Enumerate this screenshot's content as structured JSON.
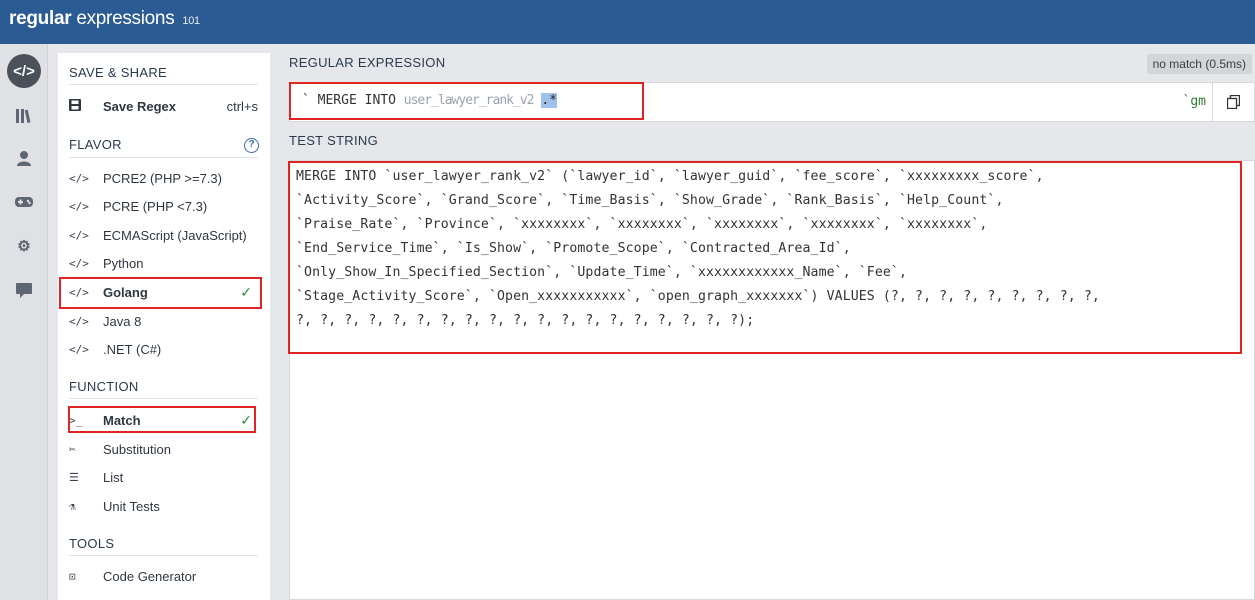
{
  "app": {
    "logo_main": "regular",
    "logo_sub": "expressions",
    "logo_num": "101"
  },
  "iconbar": {
    "items": [
      {
        "name": "code-icon",
        "glyph": "</>"
      },
      {
        "name": "library-icon",
        "glyph": "|||"
      },
      {
        "name": "user-icon",
        "glyph": "●"
      },
      {
        "name": "gamepad-icon",
        "glyph": "▬"
      },
      {
        "name": "gear-icon",
        "glyph": "⚙"
      },
      {
        "name": "chat-icon",
        "glyph": "▬"
      }
    ]
  },
  "sidebar": {
    "save_share_title": "SAVE & SHARE",
    "save_regex_label": "Save Regex",
    "save_regex_shortcut": "ctrl+s",
    "flavor_title": "FLAVOR",
    "flavors": [
      {
        "label": "PCRE2 (PHP >=7.3)"
      },
      {
        "label": "PCRE (PHP <7.3)"
      },
      {
        "label": "ECMAScript (JavaScript)"
      },
      {
        "label": "Python"
      },
      {
        "label": "Golang",
        "selected": true
      },
      {
        "label": "Java 8"
      },
      {
        "label": ".NET (C#)"
      }
    ],
    "function_title": "FUNCTION",
    "functions": [
      {
        "label": "Match",
        "selected": true
      },
      {
        "label": "Substitution"
      },
      {
        "label": "List"
      },
      {
        "label": "Unit Tests"
      }
    ],
    "tools_title": "TOOLS",
    "tools": [
      {
        "label": "Code Generator"
      }
    ]
  },
  "main": {
    "regex_label": "REGULAR EXPRESSION",
    "match_badge": "no match (0.5ms)",
    "regex_delim_open": "`",
    "regex_prefix": "MERGE INTO",
    "regex_obscured": "user_lawyer_rank_v2",
    "regex_highlight": ".*",
    "regex_flags": "`gm",
    "test_label": "TEST STRING",
    "test_lines": [
      "MERGE INTO `user_lawyer_rank_v2` (`lawyer_id`, `lawyer_guid`, `fee_score`, `xxxxxxxxx_score`,",
      "`Activity_Score`, `Grand_Score`, `Time_Basis`, `Show_Grade`, `Rank_Basis`, `Help_Count`,",
      "`Praise_Rate`, `Province`, `xxxxxxxx`, `xxxxxxxx`, `xxxxxxxx`, `xxxxxxxx`, `xxxxxxxx`,",
      "`End_Service_Time`, `Is_Show`, `Promote_Scope`, `Contracted_Area_Id`,",
      "`Only_Show_In_Specified_Section`, `Update_Time`, `xxxxxxxxxxxx_Name`, `Fee`,",
      "`Stage_Activity_Score`, `Open_xxxxxxxxxxx`, `open_graph_xxxxxxx`) VALUES (?, ?, ?, ?, ?, ?, ?, ?, ?,",
      "?, ?, ?, ?, ?, ?, ?, ?, ?, ?, ?, ?, ?, ?, ?, ?, ?, ?, ?);"
    ]
  }
}
